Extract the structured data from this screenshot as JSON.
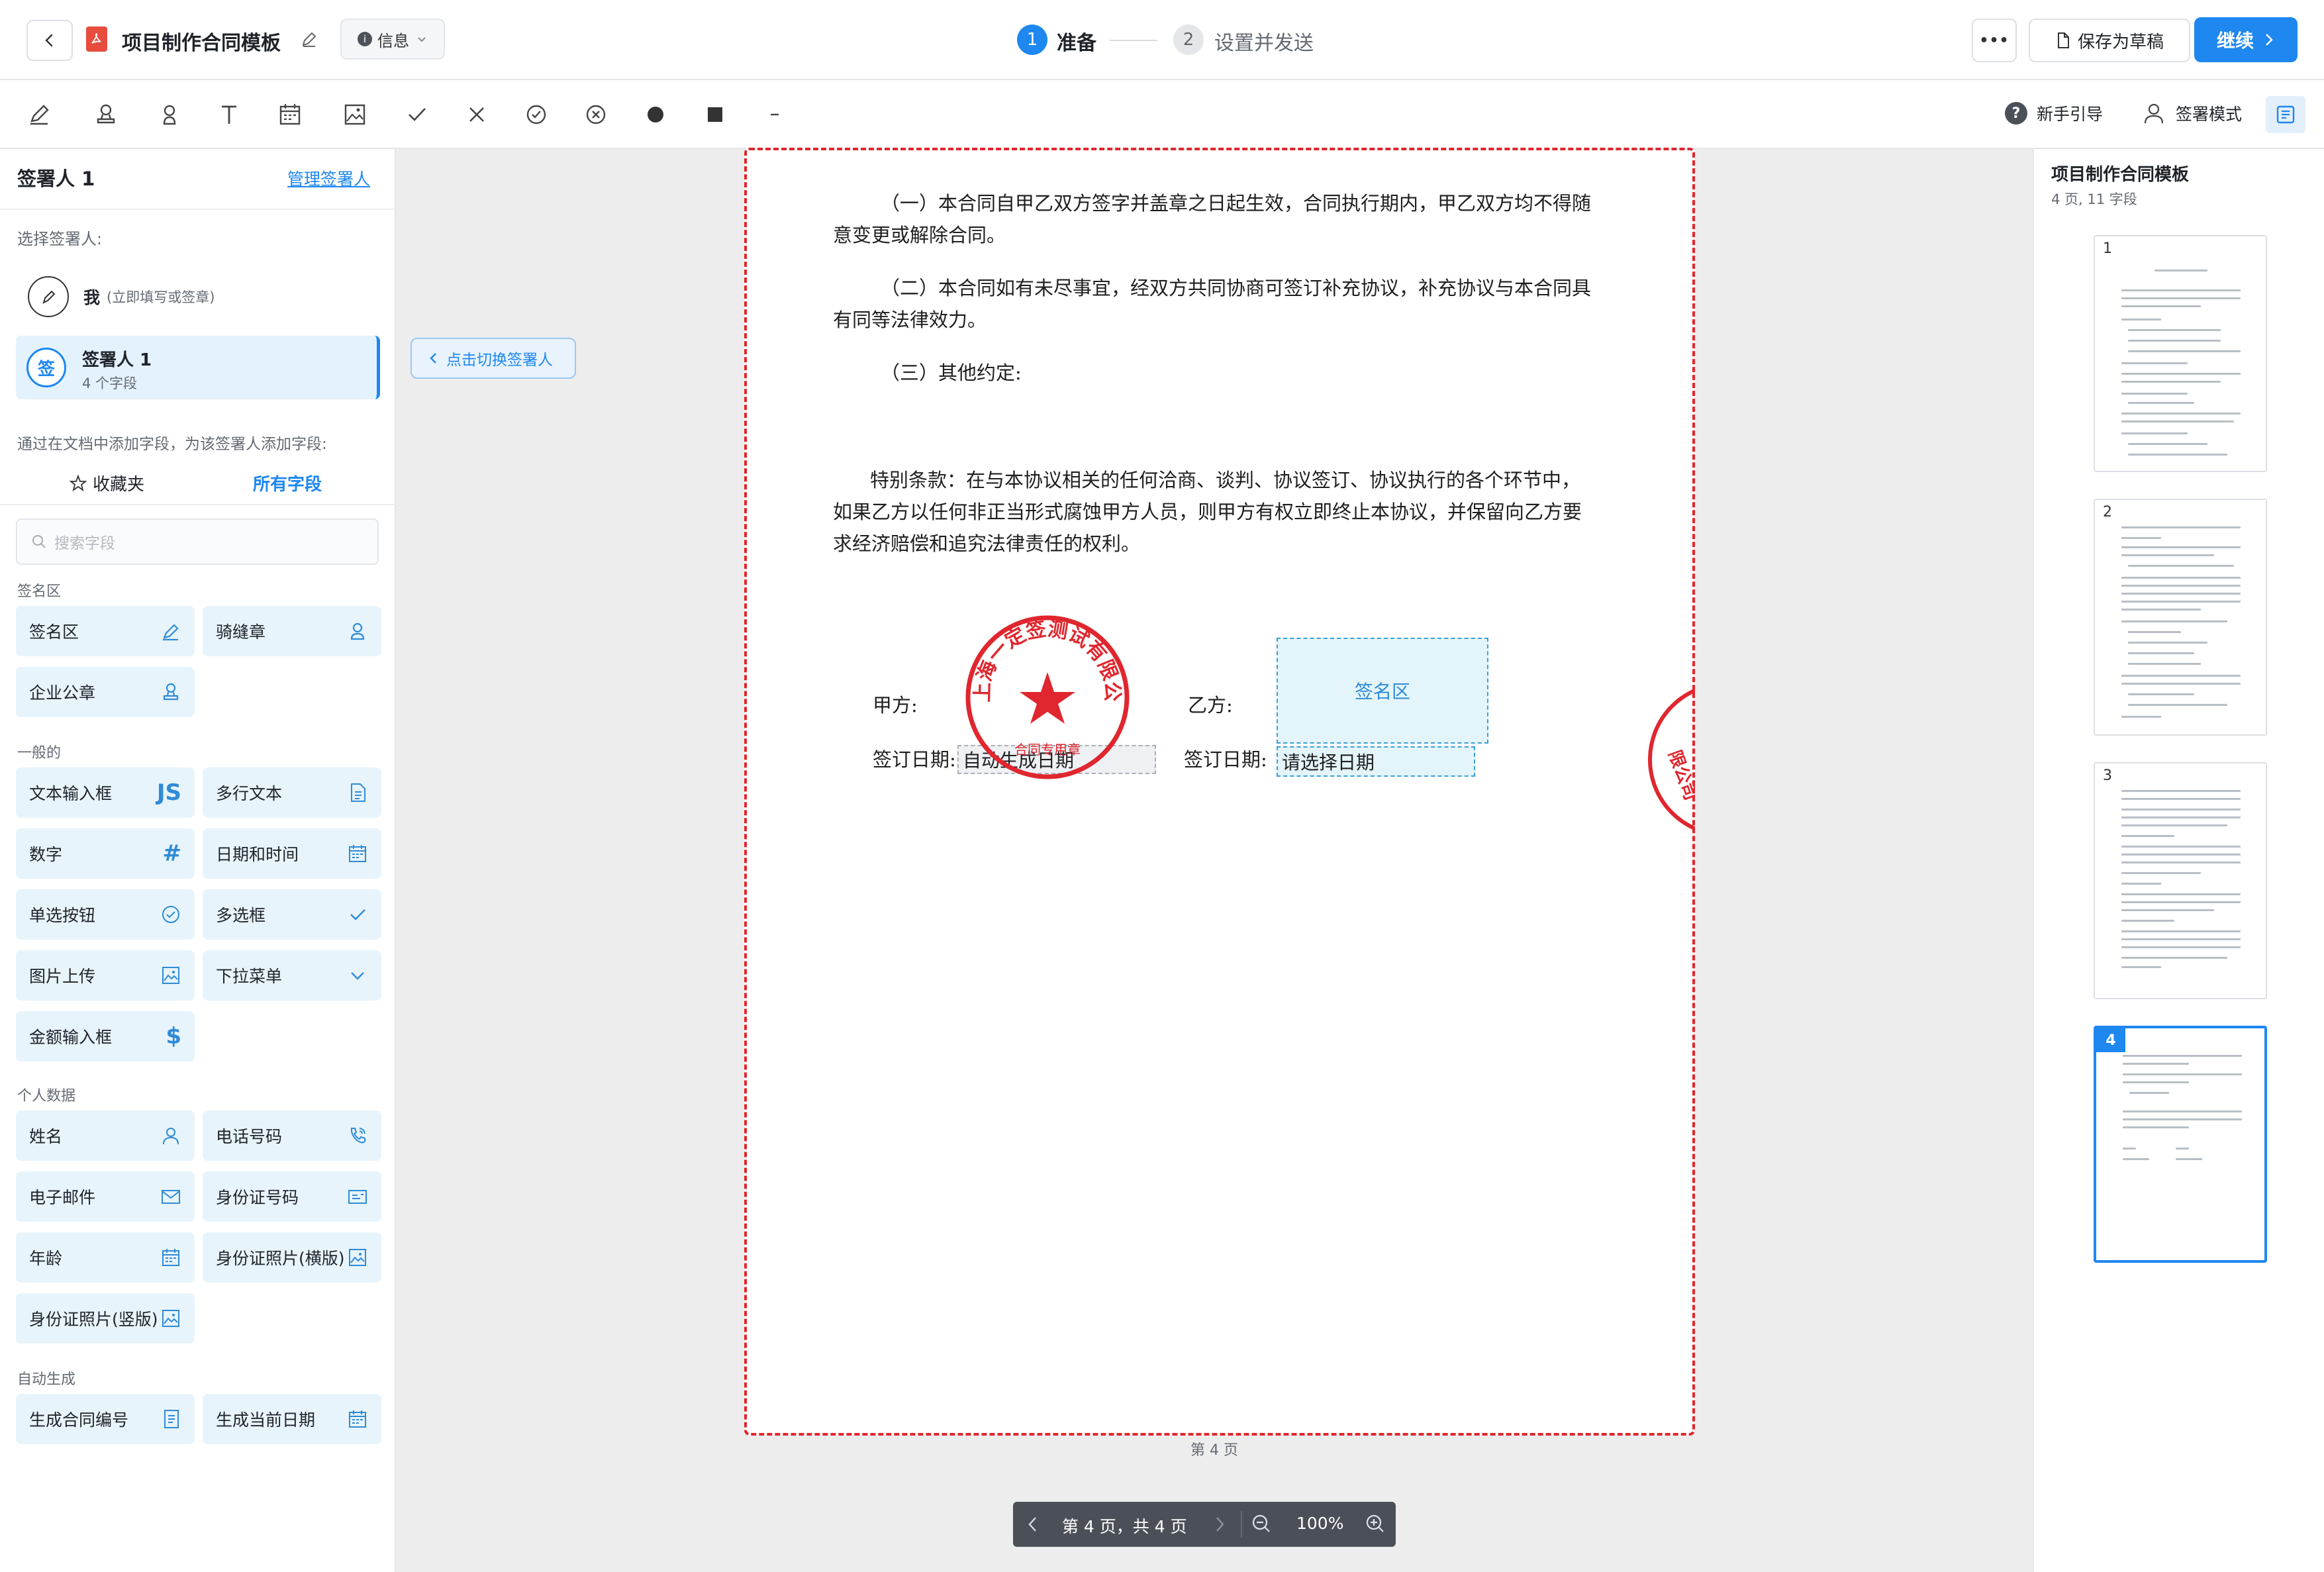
{
  "header": {
    "title": "项目制作合同模板",
    "info_label": "信息",
    "step1_num": "1",
    "step1_label": "准备",
    "step2_num": "2",
    "step2_label": "设置并发送",
    "more_label": "•••",
    "save_draft_label": "保存为草稿",
    "continue_label": "继续"
  },
  "toolbar": {
    "guide_label": "新手引导",
    "signer_mode_label": "签署模式"
  },
  "left": {
    "signer_title": "签署人 1",
    "manage_label": "管理签署人",
    "choose_label": "选择签署人:",
    "me_label": "我",
    "me_hint": "(立即填写或签章)",
    "signer1_avatar": "签",
    "signer1_name": "签署人 1",
    "signer1_fields": "4 个字段",
    "switch_tip": "点击切换签署人",
    "add_hint": "通过在文档中添加字段，为该签署人添加字段:",
    "tab_favorites": "收藏夹",
    "tab_all": "所有字段",
    "search_placeholder": "搜索字段",
    "sections": {
      "sign": "签名区",
      "general": "一般的",
      "personal": "个人数据",
      "auto": "自动生成"
    },
    "fields": {
      "sign_area": "签名区",
      "seam_seal": "骑缝章",
      "company_seal": "企业公章",
      "text_input": "文本输入框",
      "multi_text": "多行文本",
      "number": "数字",
      "datetime": "日期和时间",
      "radio": "单选按钮",
      "checkbox": "多选框",
      "image_upload": "图片上传",
      "dropdown": "下拉菜单",
      "amount": "金额输入框",
      "name": "姓名",
      "phone": "电话号码",
      "email": "电子邮件",
      "id_number": "身份证号码",
      "age": "年龄",
      "id_photo_h": "身份证照片(横版)",
      "id_photo_v": "身份证照片(竖版)",
      "contract_no": "生成合同编号",
      "current_date": "生成当前日期"
    },
    "field_icons": {
      "text_input": "JS",
      "number": "#",
      "amount": "$"
    }
  },
  "document": {
    "para1": "（一）本合同自甲乙双方签字并盖章之日起生效，合同执行期内，甲乙双方均不得随意变更或解除合同。",
    "para2": "（二）本合同如有未尽事宜，经双方共同协商可签订补充协议，补充协议与本合同具有同等法律效力。",
    "para3": "（三）其他约定:",
    "para4": "特别条款：在与本协议相关的任何洽商、谈判、协议签订、协议执行的各个环节中，如果乙方以任何非正当形式腐蚀甲方人员，则甲方有权立即终止本协议，并保留向乙方要求经济赔偿和追究法律责任的权利。",
    "party_a": "甲方:",
    "party_b": "乙方:",
    "sign_date_a": "签订日期:",
    "sign_date_b": "签订日期:",
    "auto_date_field": "自动生成日期",
    "choose_date_field": "请选择日期",
    "sign_area_field": "签名区",
    "seal_company": "上海一定签测试有限公司",
    "seal_sub": "合同专用章",
    "seam_seal_text": "限公司",
    "page_label": "第 4 页"
  },
  "right": {
    "title": "项目制作合同模板",
    "meta": "4 页, 11 字段",
    "thumbs": [
      "1",
      "2",
      "3",
      "4"
    ]
  },
  "pager": {
    "page_info": "第 4 页，共 4 页",
    "zoom": "100%"
  },
  "colors": {
    "primary": "#1e87f0",
    "seal_red": "#e0262e",
    "field_bg": "#e7f4fb",
    "field_icon": "#2f8bd6"
  }
}
